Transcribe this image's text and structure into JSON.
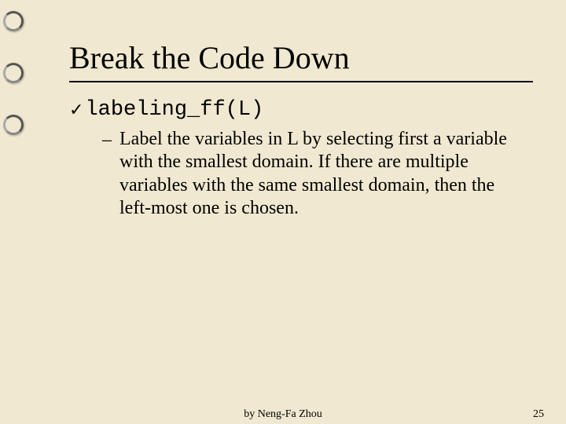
{
  "slide": {
    "title": "Break the Code Down",
    "bullet_code": "labeling_ff(L)",
    "sub_bullet_text": "Label the variables in L by selecting first a variable with the smallest domain. If there are multiple variables with the same smallest domain, then the left-most one is chosen."
  },
  "footer": {
    "author": "by Neng-Fa Zhou",
    "page_number": "25"
  }
}
